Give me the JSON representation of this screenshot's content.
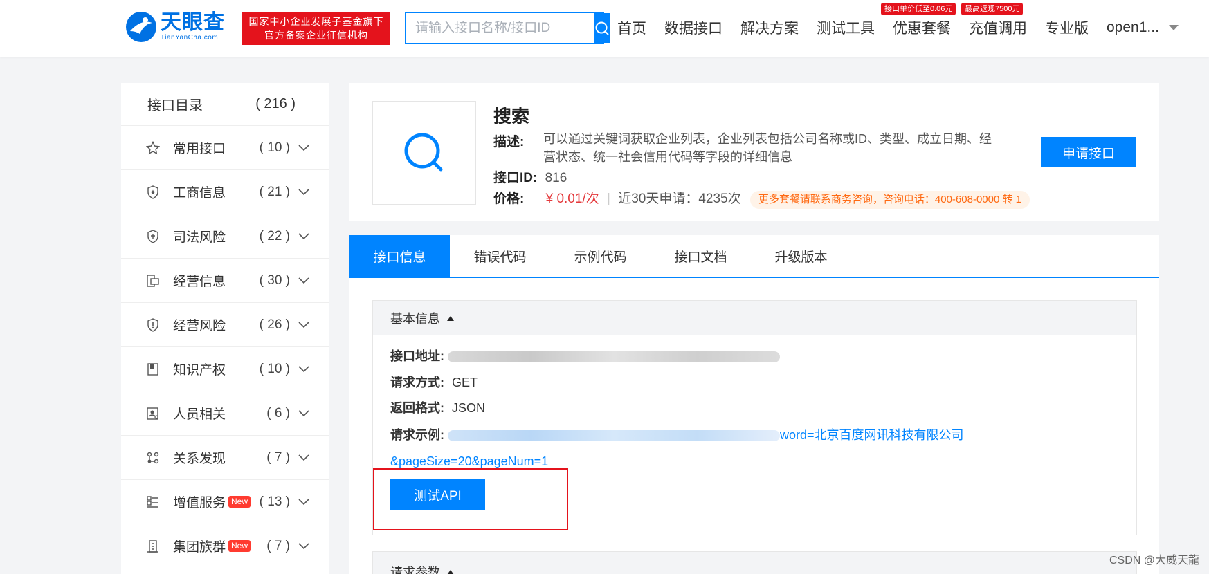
{
  "header": {
    "logo_cn": "天眼查",
    "logo_en": "TianYanCha.com",
    "cert_line1": "国家中小企业发展子基金旗下",
    "cert_line2": "官方备案企业征信机构",
    "search_placeholder": "请输入接口名称/接口ID",
    "nav": [
      {
        "label": "首页"
      },
      {
        "label": "数据接口"
      },
      {
        "label": "解决方案"
      },
      {
        "label": "测试工具"
      },
      {
        "label": "优惠套餐",
        "badge": "接口单价低至0.06元"
      },
      {
        "label": "充值调用",
        "badge": "最高返现7500元"
      },
      {
        "label": "专业版"
      }
    ],
    "user": "open1..."
  },
  "sidebar": {
    "title": "接口目录",
    "total": "( 216 )",
    "items": [
      {
        "label": "常用接口",
        "count": "( 10 )",
        "icon": "star-icon"
      },
      {
        "label": "工商信息",
        "count": "( 21 )",
        "icon": "badge-icon"
      },
      {
        "label": "司法风险",
        "count": "( 22 )",
        "icon": "shield-law-icon"
      },
      {
        "label": "经营信息",
        "count": "( 30 )",
        "icon": "monitor-icon"
      },
      {
        "label": "经营风险",
        "count": "( 26 )",
        "icon": "alert-shield-icon"
      },
      {
        "label": "知识产权",
        "count": "( 10 )",
        "icon": "book-icon"
      },
      {
        "label": "人员相关",
        "count": "( 6 )",
        "icon": "person-search-icon"
      },
      {
        "label": "关系发现",
        "count": "( 7 )",
        "icon": "relation-icon"
      },
      {
        "label": "增值服务",
        "count": "( 13 )",
        "icon": "list-icon",
        "new": "New"
      },
      {
        "label": "集团族群",
        "count": "( 7 )",
        "icon": "building-icon",
        "new": "New"
      }
    ]
  },
  "api": {
    "title": "搜索",
    "desc_label": "描述:",
    "desc": "可以通过关键词获取企业列表，企业列表包括公司名称或ID、类型、成立日期、经营状态、统一社会信用代码等字段的详细信息",
    "id_label": "接口ID:",
    "id": "816",
    "price_label": "价格:",
    "price": "¥ 0.01/次",
    "applies": "近30天申请：4235次",
    "promo": "更多套餐请联系商务咨询，咨询电话：400-608-0000 转 1",
    "apply_button": "申请接口"
  },
  "tabs": [
    "接口信息",
    "错误代码",
    "示例代码",
    "接口文档",
    "升级版本"
  ],
  "basic": {
    "title": "基本信息",
    "addr_label": "接口地址:",
    "method_label": "请求方式:",
    "method": "GET",
    "format_label": "返回格式:",
    "format": "JSON",
    "example_label": "请求示例:",
    "example_tail": "word=北京百度网讯科技有限公司",
    "example_line2": "&pageSize=20&pageNum=1",
    "test_button": "测试API"
  },
  "params": {
    "title": "请求参数"
  },
  "watermark": "CSDN @大威天龍"
}
